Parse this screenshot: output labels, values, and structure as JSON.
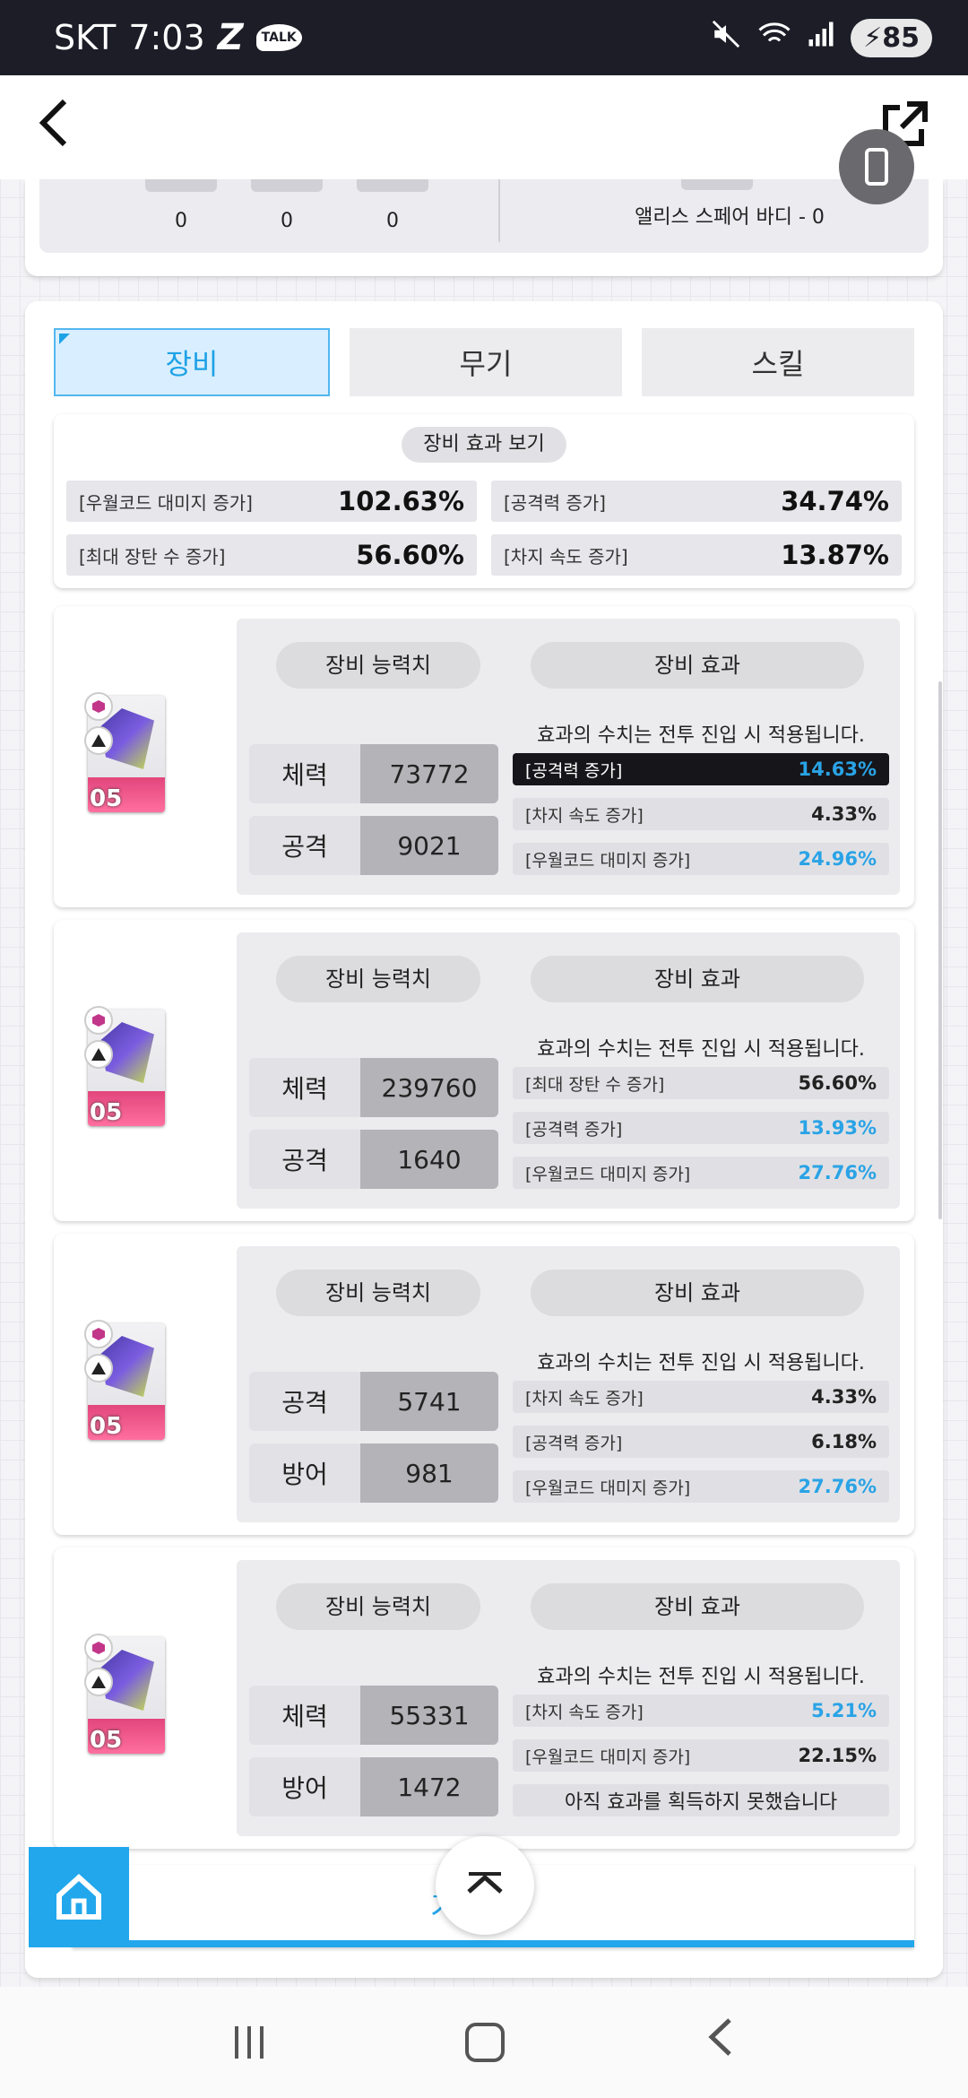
{
  "status_bar": {
    "carrier": "SKT",
    "time": "7:03",
    "talk": "TALK",
    "battery": "85"
  },
  "top_card": {
    "stats": [
      "0",
      "0",
      "0"
    ],
    "right_text": "앨리스 스페어 바디 - 0"
  },
  "tabs": [
    {
      "label": "장비",
      "active": true
    },
    {
      "label": "무기",
      "active": false
    },
    {
      "label": "스킬",
      "active": false
    }
  ],
  "effect_summary": {
    "title": "장비 효과 보기",
    "rows": [
      {
        "label": "[우월코드 대미지 증가]",
        "value": "102.63%"
      },
      {
        "label": "[공격력 증가]",
        "value": "34.74%"
      },
      {
        "label": "[최대 장탄 수 증가]",
        "value": "56.60%"
      },
      {
        "label": "[차지 속도 증가]",
        "value": "13.87%"
      }
    ]
  },
  "equipment_labels": {
    "stats_title": "장비 능력치",
    "effects_title": "장비 효과",
    "effect_note": "효과의 수치는 전투 진입 시 적용됩니다."
  },
  "equipment": [
    {
      "level": "05",
      "stats": [
        {
          "k": "체력",
          "v": "73772"
        },
        {
          "k": "공격",
          "v": "9021"
        }
      ],
      "effects": [
        {
          "label": "[공격력 증가]",
          "value": "14.63%",
          "highlight": true,
          "blue": true
        },
        {
          "label": "[차지 속도 증가]",
          "value": "4.33%",
          "highlight": false,
          "blue": false
        },
        {
          "label": "[우월코드 대미지 증가]",
          "value": "24.96%",
          "highlight": false,
          "blue": true
        }
      ]
    },
    {
      "level": "05",
      "stats": [
        {
          "k": "체력",
          "v": "239760"
        },
        {
          "k": "공격",
          "v": "1640"
        }
      ],
      "effects": [
        {
          "label": "[최대 장탄 수 증가]",
          "value": "56.60%",
          "highlight": false,
          "blue": false
        },
        {
          "label": "[공격력 증가]",
          "value": "13.93%",
          "highlight": false,
          "blue": true
        },
        {
          "label": "[우월코드 대미지 증가]",
          "value": "27.76%",
          "highlight": false,
          "blue": true
        }
      ]
    },
    {
      "level": "05",
      "stats": [
        {
          "k": "공격",
          "v": "5741"
        },
        {
          "k": "방어",
          "v": "981"
        }
      ],
      "effects": [
        {
          "label": "[차지 속도 증가]",
          "value": "4.33%",
          "highlight": false,
          "blue": false
        },
        {
          "label": "[공격력 증가]",
          "value": "6.18%",
          "highlight": false,
          "blue": false
        },
        {
          "label": "[우월코드 대미지 증가]",
          "value": "27.76%",
          "highlight": false,
          "blue": true
        }
      ]
    },
    {
      "level": "05",
      "stats": [
        {
          "k": "체력",
          "v": "55331"
        },
        {
          "k": "방어",
          "v": "1472"
        }
      ],
      "effects": [
        {
          "label": "[차지 속도 증가]",
          "value": "5.21%",
          "highlight": false,
          "blue": true
        },
        {
          "label": "[우월코드 대미지 증가]",
          "value": "22.15%",
          "highlight": false,
          "blue": false
        },
        {
          "label": "아직 효과를 획득하지 못했습니다",
          "value": "",
          "highlight": false,
          "blue": false,
          "empty": true
        }
      ]
    }
  ],
  "bottom_tab_label": "기",
  "colors": {
    "accent_blue": "#22a7ec",
    "highlight_bg": "#16161a",
    "gear_pink": "#ff6f9f"
  }
}
